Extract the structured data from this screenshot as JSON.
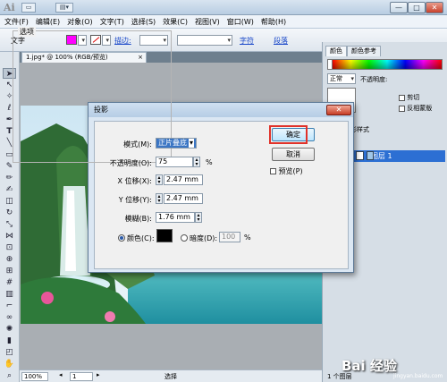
{
  "app": {
    "logo": "Ai"
  },
  "window_controls": {
    "minimize": "—",
    "maximize": "□",
    "close": "✕"
  },
  "menu": [
    "文件(F)",
    "编辑(E)",
    "对象(O)",
    "文字(T)",
    "选择(S)",
    "效果(C)",
    "视图(V)",
    "窗口(W)",
    "帮助(H)"
  ],
  "control_bar": {
    "tool_label": "文字",
    "stroke_label": "描边:",
    "char_link": "字符",
    "para_link": "段落"
  },
  "document": {
    "tab_title": "1.jpg* @ 100% (RGB/预览)",
    "tab_close": "×"
  },
  "status_bar": {
    "zoom": "100%",
    "page": "1",
    "mode": "选择"
  },
  "panels": {
    "color_tab": "颜色",
    "color_ref_tab": "颜色参考",
    "blend_mode": "正常",
    "opacity_label": "不透明度:",
    "clip_label": "剪切",
    "invert_mask_label": "反相蒙版",
    "graphic_styles_fragment": "形样式",
    "layer_name": "图层 1",
    "layer_count": "1 个图层"
  },
  "dialog": {
    "title": "投影",
    "close": "✕",
    "group_title": "选项",
    "mode_label": "模式(M):",
    "mode_value": "正片叠底",
    "opacity_label": "不透明度(O):",
    "opacity_value": "75",
    "opacity_unit": "%",
    "x_offset_label": "X 位移(X):",
    "x_offset_value": "2.47 mm",
    "y_offset_label": "Y 位移(Y):",
    "y_offset_value": "2.47 mm",
    "blur_label": "模糊(B):",
    "blur_value": "1.76 mm",
    "color_label": "颜色(C):",
    "darkness_label": "暗度(D):",
    "darkness_value": "100",
    "darkness_unit": "%",
    "ok_label": "确定",
    "cancel_label": "取消",
    "preview_label": "预览(P)",
    "shadow_color": "#000000"
  },
  "watermark": {
    "text": "Bai 经验",
    "sub": "jingyan.baidu.com"
  }
}
